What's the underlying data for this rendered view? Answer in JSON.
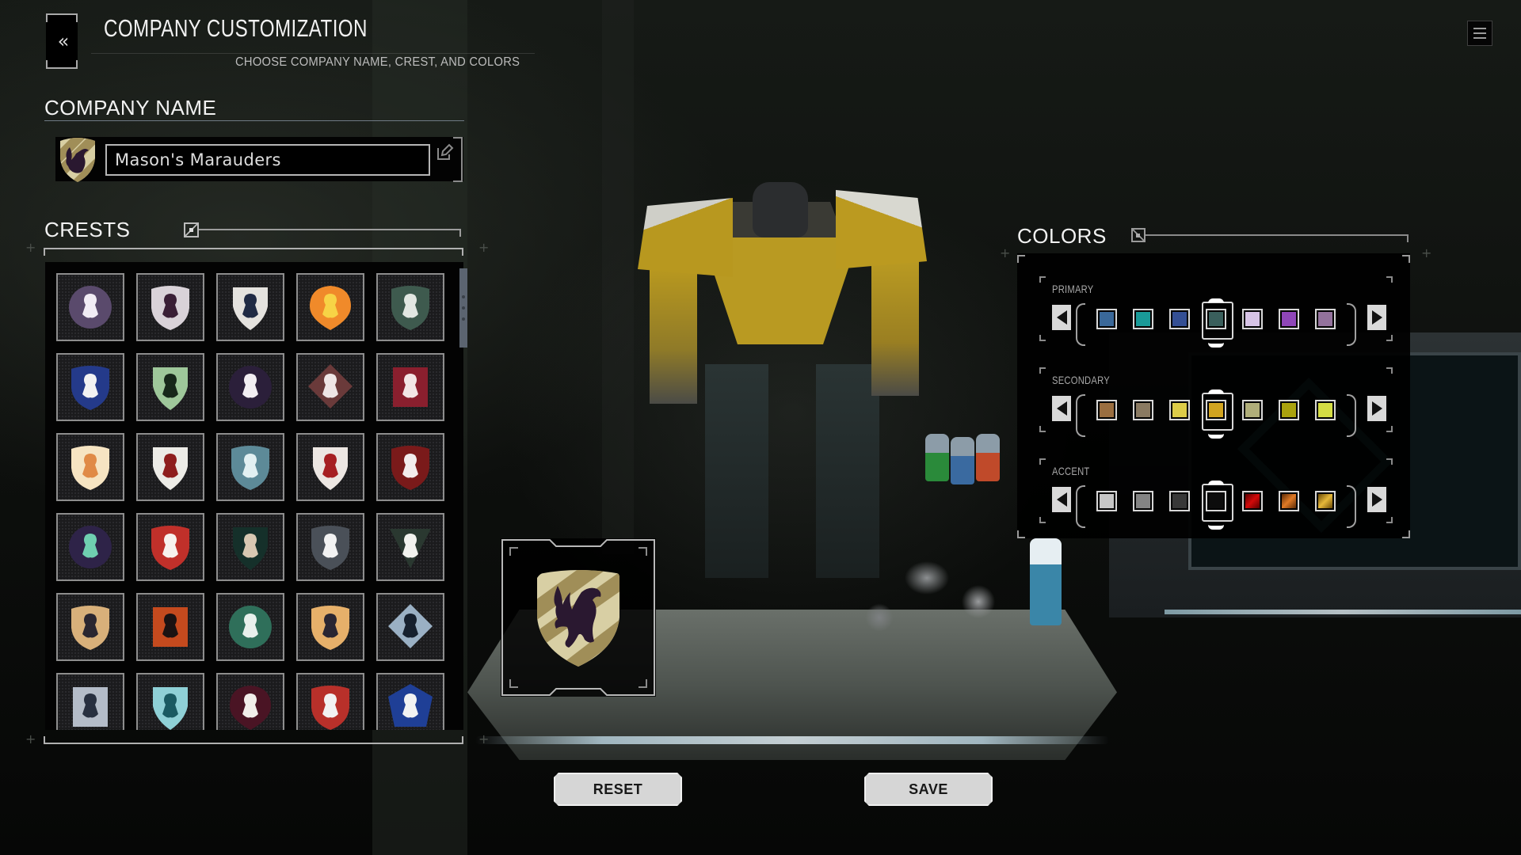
{
  "header": {
    "back_icon": "double-chevron-left-icon",
    "back_glyph": "«",
    "title": "COMPANY CUSTOMIZATION",
    "subtitle": "CHOOSE COMPANY NAME, CREST, AND COLORS",
    "menu_icon": "hamburger-menu-icon"
  },
  "company_name": {
    "title": "COMPANY NAME",
    "value": "Mason's Marauders",
    "selected_crest": "griffin-striped-shield",
    "edit_icon": "edit-pencil-icon"
  },
  "crests": {
    "title": "CRESTS",
    "toggle_icon": "expand-toggle-icon",
    "items": [
      {
        "name": "griffin-purple-disc",
        "bg": "#5a4a6c",
        "fg": "#f1ecf4",
        "shape": "circle"
      },
      {
        "name": "bear-white-shield",
        "bg": "#d9d2d8",
        "fg": "#3a1f36",
        "shape": "shield"
      },
      {
        "name": "griffin-white-shield",
        "bg": "#e4e2de",
        "fg": "#1f2a44",
        "shape": "pointed"
      },
      {
        "name": "crown-orange-disc",
        "bg": "#f08a2a",
        "fg": "#f7d346",
        "shape": "drop"
      },
      {
        "name": "dragon-skull-green-shield",
        "bg": "#3e5a4e",
        "fg": "#e2e7e2",
        "shape": "shield"
      },
      {
        "name": "lion-blue-shield",
        "bg": "#243a8a",
        "fg": "#f2f2f2",
        "shape": "shield"
      },
      {
        "name": "knight-green-shield",
        "bg": "#9ec79a",
        "fg": "#17271a",
        "shape": "pointed"
      },
      {
        "name": "moth-purple-disc",
        "bg": "#2b1f3a",
        "fg": "#f2eef2",
        "shape": "circle"
      },
      {
        "name": "knight-split-diamond",
        "bg": "#6a3a3a",
        "fg": "#efe6e6",
        "shape": "diamond"
      },
      {
        "name": "knight-red-square",
        "bg": "#8a1f2e",
        "fg": "#f2e6e6",
        "shape": "square"
      },
      {
        "name": "wings-cream-shield",
        "bg": "#f6e4c2",
        "fg": "#e08a46",
        "shape": "shield"
      },
      {
        "name": "spartan-white-shield",
        "bg": "#ecebe6",
        "fg": "#8e1d1d",
        "shape": "pointed"
      },
      {
        "name": "kraken-teal-shield",
        "bg": "#5d8a98",
        "fg": "#e2f0f2",
        "shape": "shield"
      },
      {
        "name": "blood-drops-white-shield",
        "bg": "#ece6e2",
        "fg": "#a61f22",
        "shape": "pointed"
      },
      {
        "name": "kraken-red-shield",
        "bg": "#7a1a1a",
        "fg": "#f2ecec",
        "shape": "shield"
      },
      {
        "name": "lotus-teal-disc",
        "bg": "#2e2348",
        "fg": "#6fcfb0",
        "shape": "circle"
      },
      {
        "name": "lion-red-banner",
        "bg": "#c0302a",
        "fg": "#f7f2ee",
        "shape": "shield"
      },
      {
        "name": "ram-dark-shield",
        "bg": "#15302a",
        "fg": "#d8c8b2",
        "shape": "pointed"
      },
      {
        "name": "horse-grey-shield",
        "bg": "#4a5058",
        "fg": "#f2f2f2",
        "shape": "shield"
      },
      {
        "name": "ram-green-triangle",
        "bg": "#2a3830",
        "fg": "#f2f2ee",
        "shape": "triangle"
      },
      {
        "name": "demon-gold-shield",
        "bg": "#d8b07a",
        "fg": "#2a2630",
        "shape": "shield"
      },
      {
        "name": "dragon-orange-banner",
        "bg": "#c44a1e",
        "fg": "#1a1212",
        "shape": "square"
      },
      {
        "name": "triskele-green-disc",
        "bg": "#2f6f5a",
        "fg": "#e8f0ec",
        "shape": "circle"
      },
      {
        "name": "sword-gold-shield",
        "bg": "#e6b06a",
        "fg": "#2a2632",
        "shape": "shield"
      },
      {
        "name": "eagle-blue-quatrefoil",
        "bg": "#9ab0c4",
        "fg": "#16202e",
        "shape": "diamond"
      },
      {
        "name": "hawk-grey-banner",
        "bg": "#b4bcc8",
        "fg": "#283040",
        "shape": "square"
      },
      {
        "name": "face-teal-shield",
        "bg": "#8fd0d6",
        "fg": "#1a5a62",
        "shape": "pointed"
      },
      {
        "name": "stag-skull-maroon",
        "bg": "#4a1424",
        "fg": "#f2eeea",
        "shape": "drop"
      },
      {
        "name": "spider-split-shield",
        "bg": "#b8302a",
        "fg": "#f2f2f2",
        "shape": "shield"
      },
      {
        "name": "spider-blue-pentagon",
        "bg": "#1f3f96",
        "fg": "#f2f2f2",
        "shape": "pentagon"
      }
    ],
    "selected_index": -1
  },
  "colors": {
    "title": "COLORS",
    "toggle_icon": "expand-toggle-icon",
    "groups": [
      {
        "label": "PRIMARY",
        "swatches": [
          "#3a6899",
          "#1a9a98",
          "#344f94",
          "#3a5f5c",
          "#d7c4e6",
          "#8f46b8",
          "#93729c"
        ],
        "selected_index": 3,
        "selected_color": "#3a5f5c"
      },
      {
        "label": "SECONDARY",
        "swatches": [
          "#9a6e40",
          "#8a7a62",
          "#ddcc48",
          "#d1a420",
          "#b0ae7a",
          "#aaa20e",
          "#d4dc44"
        ],
        "selected_index": 3,
        "selected_color": "#d1a420"
      },
      {
        "label": "ACCENT",
        "swatches": [
          "#c6c6c6",
          "#848484",
          "#383838",
          "#0c0c0c",
          "linear-gradient(135deg,#5a0000,#d20a0a 50%,#5a0000)",
          "linear-gradient(135deg,#5a2a06,#e07a26 50%,#5a2a06)",
          "linear-gradient(135deg,#6a4a06,#e6b83a 50%,#6a4a06)"
        ],
        "selected_index": 3,
        "selected_color": "#0c0c0c"
      }
    ],
    "prev_icon": "arrow-left-icon",
    "next_icon": "arrow-right-icon"
  },
  "preview": {
    "crest": "griffin-striped-shield",
    "colors": {
      "field": "#d8cfa4",
      "stripe": "#a08e58",
      "figure": "#2a1830"
    }
  },
  "actions": {
    "reset_label": "RESET",
    "save_label": "SAVE"
  }
}
